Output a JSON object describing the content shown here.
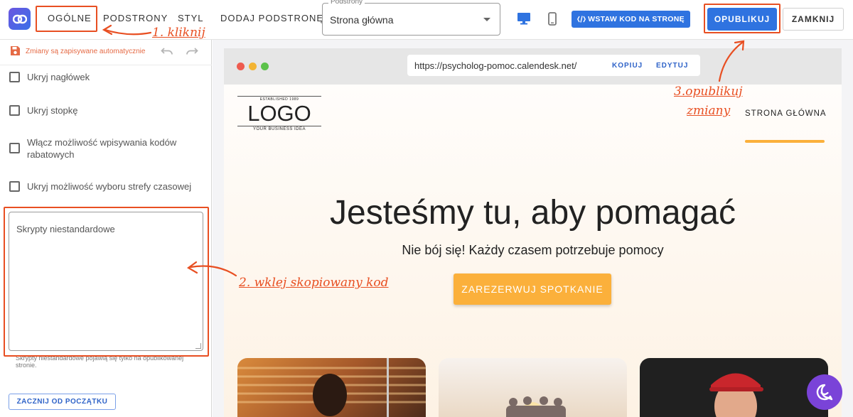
{
  "nav": {
    "tabs": [
      "OGÓLNE",
      "PODSTRONY",
      "STYL",
      "DODAJ PODSTRONĘ"
    ],
    "subpage_label": "Podstrony",
    "subpage_value": "Strona główna",
    "insert_code": "WSTAW KOD NA STRONĘ",
    "publish": "OPUBLIKUJ",
    "close": "ZAMKNIJ",
    "icons": [
      "app-logo-icon",
      "desktop-icon",
      "mobile-icon",
      "code-icon"
    ]
  },
  "sidebar": {
    "autosave": "Zmiany są zapisywane automatycznie",
    "options": [
      "Ukryj nagłówek",
      "Ukryj stopkę",
      "Włącz możliwość wpisywania kodów rabatowych",
      "Ukryj możliwość wyboru strefy czasowej"
    ],
    "scripts_placeholder": "Skrypty niestandardowe",
    "scripts_hint": "Skrypty niestandardowe pojawią się tylko na opublikowanej stronie.",
    "restart": "ZACZNIJ OD POCZĄTKU"
  },
  "preview": {
    "url": "https://psycholog-pomoc.calendesk.net/",
    "copy": "KOPIUJ",
    "edit": "EDYTUJ",
    "logo_est": "ESTABLISHED 1989",
    "logo_main": "LOGO",
    "logo_sub": "YOUR BUSINESS IDEA",
    "nav_item": "STRONA GŁÓWNA",
    "hero_title": "Jesteśmy tu, aby pomagać",
    "hero_sub": "Nie bój się! Każdy czasem potrzebuje pomocy",
    "cta": "ZAREZERWUJ SPOTKANIE"
  },
  "annotations": {
    "step1": "1. kliknij",
    "step2": "2. wklej skopiowany kod",
    "step3_line1": "3.opublikuj",
    "step3_line2": "zmiany"
  },
  "colors": {
    "accent_blue": "#2f73e0",
    "annotation_red": "#e84f22",
    "cta_orange": "#fbb03b",
    "chat_purple": "#7a43d8"
  }
}
